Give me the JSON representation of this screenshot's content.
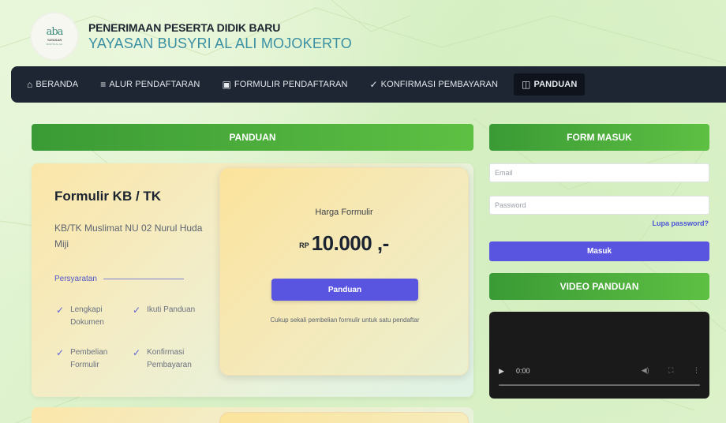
{
  "header": {
    "logo": {
      "mark": "aba",
      "line1": "YAYASAN",
      "line2": "BUSYRI AL ALI"
    },
    "title": "PENERIMAAN PESERTA DIDIK BARU",
    "subtitle": "YAYASAN BUSYRI AL ALI MOJOKERTO"
  },
  "nav": {
    "items": [
      {
        "icon": "home-icon",
        "glyph": "⌂",
        "label": "BERANDA"
      },
      {
        "icon": "list-icon",
        "glyph": "≡",
        "label": "ALUR PENDAFTARAN"
      },
      {
        "icon": "file-icon",
        "glyph": "▣",
        "label": "FORMULIR PENDAFTARAN"
      },
      {
        "icon": "check-icon",
        "glyph": "✓",
        "label": "KONFIRMASI PEMBAYARAN"
      },
      {
        "icon": "book-icon",
        "glyph": "◫",
        "label": "PANDUAN"
      }
    ]
  },
  "main": {
    "section_title": "PANDUAN",
    "card": {
      "title": "Formulir KB / TK",
      "subtitle": "KB/TK Muslimat NU 02 Nurul Huda Miji",
      "requirements_label": "Persyaratan",
      "requirements": [
        "Lengkapi Dokumen",
        "Ikuti Panduan",
        "Pembelian Formulir",
        "Konfirmasi Pembayaran"
      ],
      "price_label": "Harga Formulir",
      "currency": "RP",
      "price": "10.000 ,-",
      "button": "Panduan",
      "note": "Cukup sekali pembelian formulir untuk satu pendaftar"
    }
  },
  "sidebar": {
    "login_title": "FORM MASUK",
    "email_placeholder": "Email",
    "password_placeholder": "Password",
    "forgot": "Lupa password?",
    "login_button": "Masuk",
    "video_title": "VIDEO PANDUAN",
    "video_time": "0:00"
  },
  "colors": {
    "accent": "#5a55e0",
    "green": "#4caf3f",
    "nav": "#1e2633"
  }
}
